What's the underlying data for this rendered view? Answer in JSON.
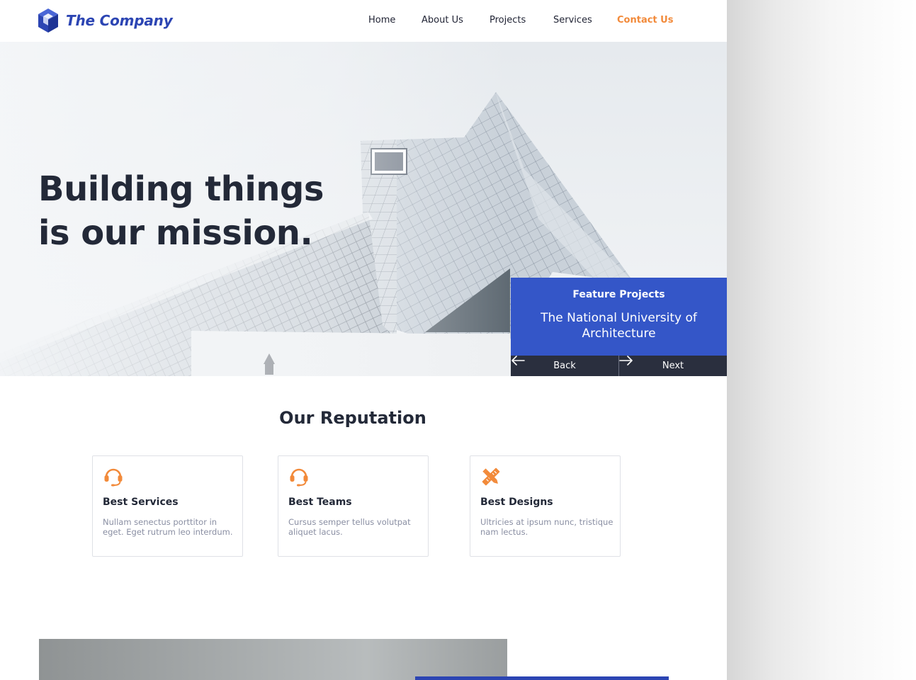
{
  "header": {
    "brand": "The Company",
    "nav": [
      {
        "label": "Home"
      },
      {
        "label": "About Us"
      },
      {
        "label": "Projects"
      },
      {
        "label": "Services"
      },
      {
        "label": "Contact Us",
        "active": true
      }
    ]
  },
  "hero": {
    "title_line1": "Building things",
    "title_line2": "is our mission.",
    "feature_label": "Feature Projects",
    "feature_name": "The National University of Architecture",
    "back_label": "Back",
    "next_label": "Next"
  },
  "reputation": {
    "title": "Our Reputation",
    "cards": [
      {
        "icon": "headset-icon",
        "title": "Best Services",
        "text": "Nullam senectus porttitor in eget. Eget rutrum leo interdum."
      },
      {
        "icon": "headset-icon",
        "title": "Best Teams",
        "text": "Cursus semper tellus volutpat aliquet lacus."
      },
      {
        "icon": "design-tools-icon",
        "title": "Best Designs",
        "text": "Ultricies at ipsum nunc, tristique nam lectus."
      }
    ]
  },
  "colors": {
    "brand_blue": "#2c45b3",
    "feature_blue": "#3456c8",
    "accent_orange": "#f28a3a",
    "dark_text": "#232938",
    "muted_text": "#8a8fa3"
  }
}
